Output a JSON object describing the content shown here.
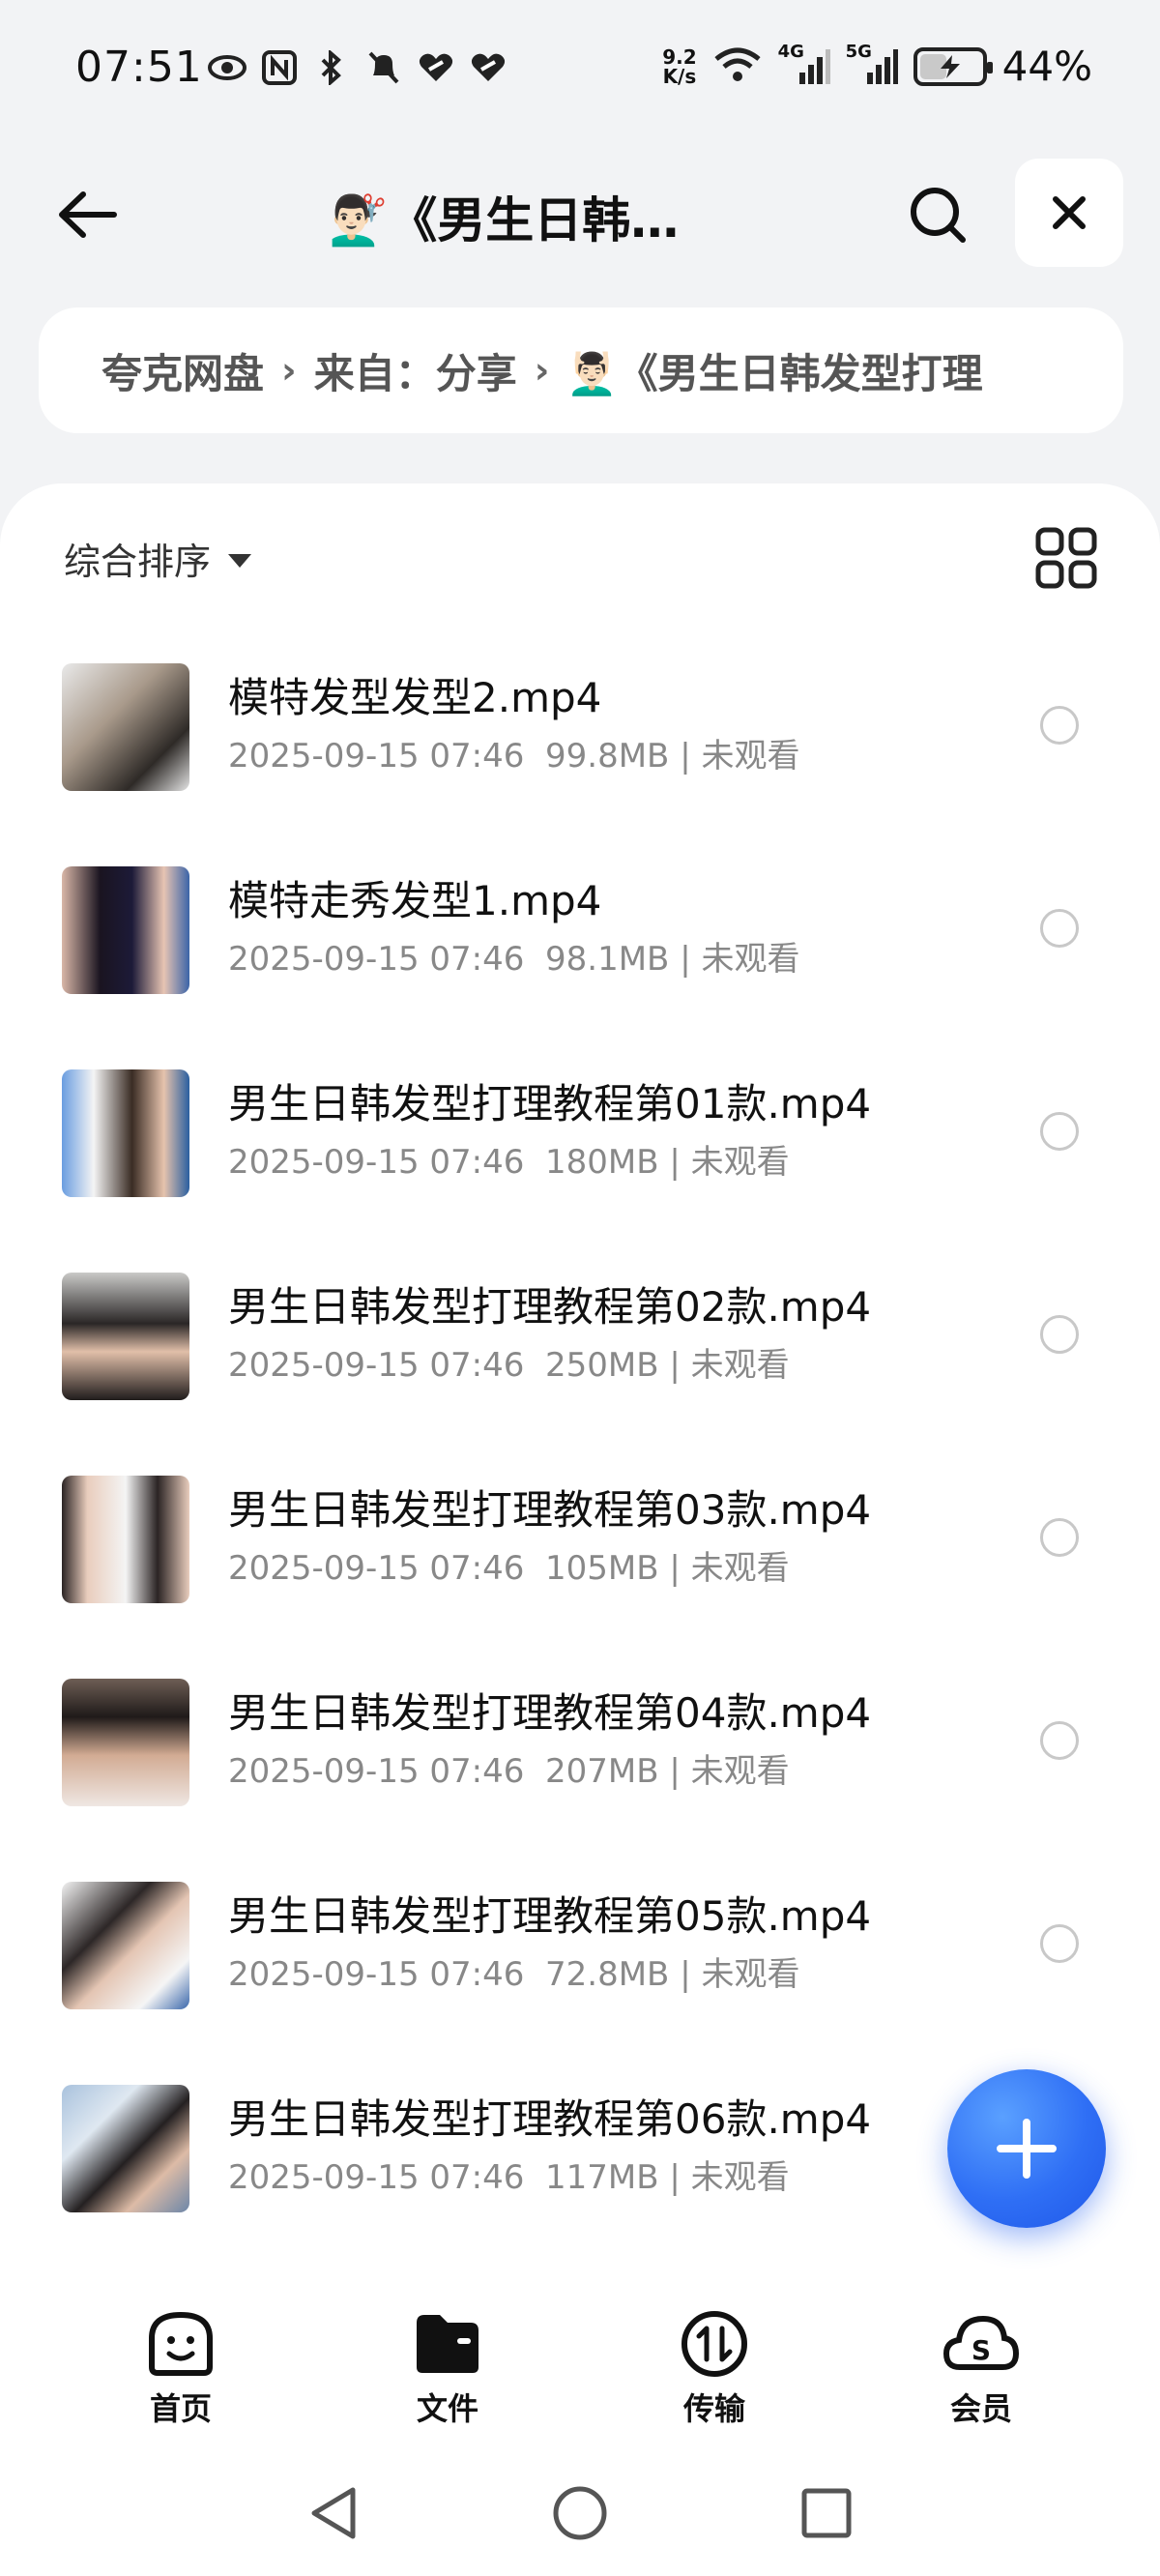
{
  "status_bar": {
    "time": "07:51",
    "net_speed_value": "9.2",
    "net_speed_unit": "K/s",
    "signal1_label": "4G",
    "signal2_label": "5G",
    "battery_percent": "44%",
    "battery_level": 0.44,
    "icons": [
      "eye-icon",
      "nfc-icon",
      "bluetooth-icon",
      "mute-bell-icon",
      "heart-link-icon",
      "heart-link-icon",
      "wifi-icon",
      "signal-icon",
      "signal-icon",
      "battery-icon"
    ]
  },
  "header": {
    "title": "💇🏻‍♂️《男生日韩…",
    "back_icon": "back-arrow-icon",
    "search_icon": "search-icon",
    "close_icon": "close-icon"
  },
  "breadcrumb": {
    "items": [
      "夸克网盘",
      "来自：分享",
      "💆🏻‍♂️《男生日韩发型打理"
    ]
  },
  "toolbar": {
    "sort_label": "综合排序",
    "view_icon": "grid-view-icon"
  },
  "files": [
    {
      "name": "模特发型发型2.mp4",
      "date": "2025-09-15 07:46",
      "size": "99.8MB",
      "status": "未观看"
    },
    {
      "name": "模特走秀发型1.mp4",
      "date": "2025-09-15 07:46",
      "size": "98.1MB",
      "status": "未观看"
    },
    {
      "name": "男生日韩发型打理教程第01款.mp4",
      "date": "2025-09-15 07:46",
      "size": "180MB",
      "status": "未观看"
    },
    {
      "name": "男生日韩发型打理教程第02款.mp4",
      "date": "2025-09-15 07:46",
      "size": "250MB",
      "status": "未观看"
    },
    {
      "name": "男生日韩发型打理教程第03款.mp4",
      "date": "2025-09-15 07:46",
      "size": "105MB",
      "status": "未观看"
    },
    {
      "name": "男生日韩发型打理教程第04款.mp4",
      "date": "2025-09-15 07:46",
      "size": "207MB",
      "status": "未观看"
    },
    {
      "name": "男生日韩发型打理教程第05款.mp4",
      "date": "2025-09-15 07:46",
      "size": "72.8MB",
      "status": "未观看"
    },
    {
      "name": "男生日韩发型打理教程第06款.mp4",
      "date": "2025-09-15 07:46",
      "size": "117MB",
      "status": "未观看"
    }
  ],
  "meta_separator": "|",
  "fab": {
    "icon": "plus-icon"
  },
  "bottom_nav": [
    {
      "label": "首页",
      "icon": "smiley-home-icon"
    },
    {
      "label": "文件",
      "icon": "folder-icon"
    },
    {
      "label": "传输",
      "icon": "transfer-icon"
    },
    {
      "label": "会员",
      "icon": "cloud-member-icon"
    }
  ],
  "system_nav": [
    "back-triangle-icon",
    "home-circle-icon",
    "recents-square-icon"
  ],
  "colors": {
    "accent": "#2f6ff5",
    "background": "#f2f3f5",
    "meta_text": "#888888"
  }
}
